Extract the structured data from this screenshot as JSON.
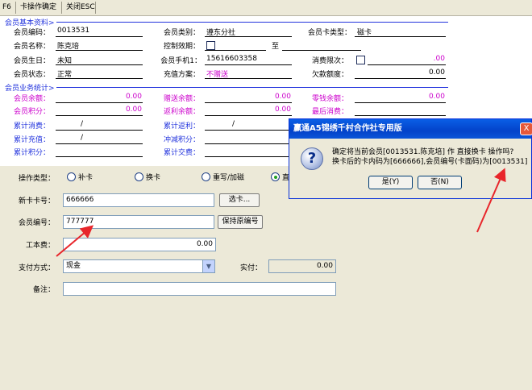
{
  "toolbar": {
    "f6_label": "F6",
    "confirm_label": "卡操作确定",
    "close_label": "关闭ESC"
  },
  "basic": {
    "header": "会员基本资料>",
    "member_id_label": "会员编码：",
    "member_id": "0013531",
    "member_type_label": "会员类别：",
    "member_type": "遵东分社",
    "card_type_label": "会员卡类型：",
    "card_type": "磁卡",
    "name_label": "会员名称：",
    "name": "陈克培",
    "validity_label": "控制效期：",
    "validity_to": "至",
    "birthday_label": "会员生日：",
    "birthday": "未知",
    "phone_label": "会员手机1：",
    "phone": "15616603358",
    "limit_label": "消费限次：",
    "limit_value": ".00",
    "status_label": "会员状态：",
    "status": "正常",
    "plan_label": "充值方案：",
    "plan": "不赠送",
    "arrears_label": "欠款额度：",
    "arrears": "0.00"
  },
  "stats": {
    "header": "会员业务统计>",
    "balance_label": "会员余额：",
    "balance": "0.00",
    "gift_label": "赠送余额：",
    "gift": "0.00",
    "change_label": "零钱余额：",
    "change": "0.00",
    "points_label": "会员积分：",
    "points": "0.00",
    "profit_label": "返利余额：",
    "profit": "0.00",
    "last_label": "最后消费：",
    "total_consume_label": "累计消费：",
    "total_consume": "/",
    "total_profit_label": "累计返利：",
    "total_profit": "/",
    "total_recharge_label": "累计充值：",
    "total_recharge": "/",
    "offset_label": "冲减积分：",
    "total_points_label": "累计积分：",
    "total_trade_label": "累计交费："
  },
  "operation": {
    "type_label": "操作类型：",
    "options": [
      "补卡",
      "换卡",
      "重写/加磁",
      "直"
    ],
    "selected_index": 3,
    "new_card_label": "新卡卡号：",
    "new_card": "666666",
    "choose_card_label": "选卡...",
    "member_no_label": "会员编号：",
    "member_no": "777777",
    "keep_no_label": "保持原编号",
    "fee_label": "工本费：",
    "fee": "0.00",
    "pay_label": "支付方式：",
    "pay_method": "现金",
    "paid_label": "实付：",
    "paid": "0.00",
    "note_label": "备注：",
    "note": ""
  },
  "dialog": {
    "title": "赢通A5锦绣千村合作社专用版",
    "line1": "确定将当前会员[0013531.陈克培] 作 直接换卡 操作吗?",
    "line2": "换卡后的卡内码为[666666],会员编号(卡面码)为[0013531]",
    "yes_label": "是(Y)",
    "no_label": "否(N)",
    "close_label": "X"
  },
  "colors": {
    "header_blue": "#2233dd",
    "accent_magenta": "#cc00cc",
    "annotation_red": "#e8262b"
  }
}
